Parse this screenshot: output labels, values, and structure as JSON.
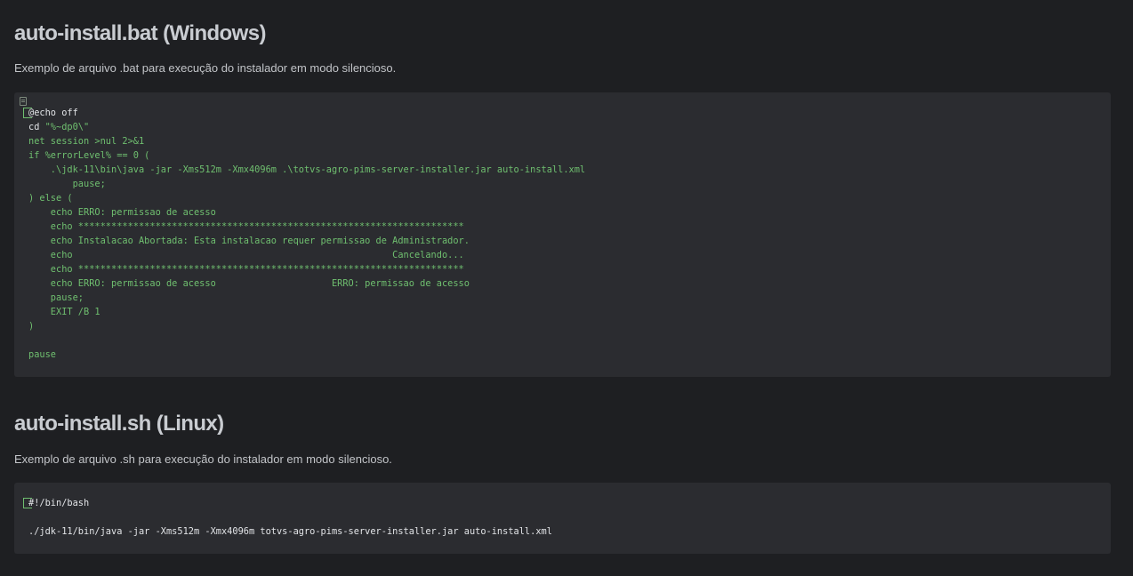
{
  "sections": [
    {
      "title": "auto-install.bat (Windows)",
      "description": "Exemplo de arquivo .bat para execução do instalador em modo silencioso.",
      "code_lines": [
        "@echo off",
        "cd \"%~dp0\\\"",
        "net session >nul 2>&1",
        "if %errorLevel% == 0 (",
        "    .\\jdk-11\\bin\\java -jar -Xms512m -Xmx4096m .\\totvs-agro-pims-server-installer.jar auto-install.xml",
        "        pause;",
        ") else (",
        "    echo ERRO: permissao de acesso",
        "    echo **********************************************************************",
        "    echo Instalacao Abortada: Esta instalacao requer permissao de Administrador.",
        "    echo                                                          Cancelando...",
        "    echo **********************************************************************",
        "    echo ERRO: permissao de acesso                     ERRO: permissao de acesso",
        "    pause;",
        "    EXIT /B 1",
        ")",
        "",
        "pause"
      ]
    },
    {
      "title": "auto-install.sh (Linux)",
      "description": "Exemplo de arquivo .sh para execução do instalador em modo silencioso.",
      "code_lines": [
        "#!/bin/bash",
        "",
        "./jdk-11/bin/java -jar -Xms512m -Xmx4096m totvs-agro-pims-server-installer.jar auto-install.xml"
      ]
    }
  ],
  "colors": {
    "background": "#1e1f22",
    "code_background": "#2b2c30",
    "code_text": "#e2e4e7",
    "code_string": "#6fbf6f"
  }
}
